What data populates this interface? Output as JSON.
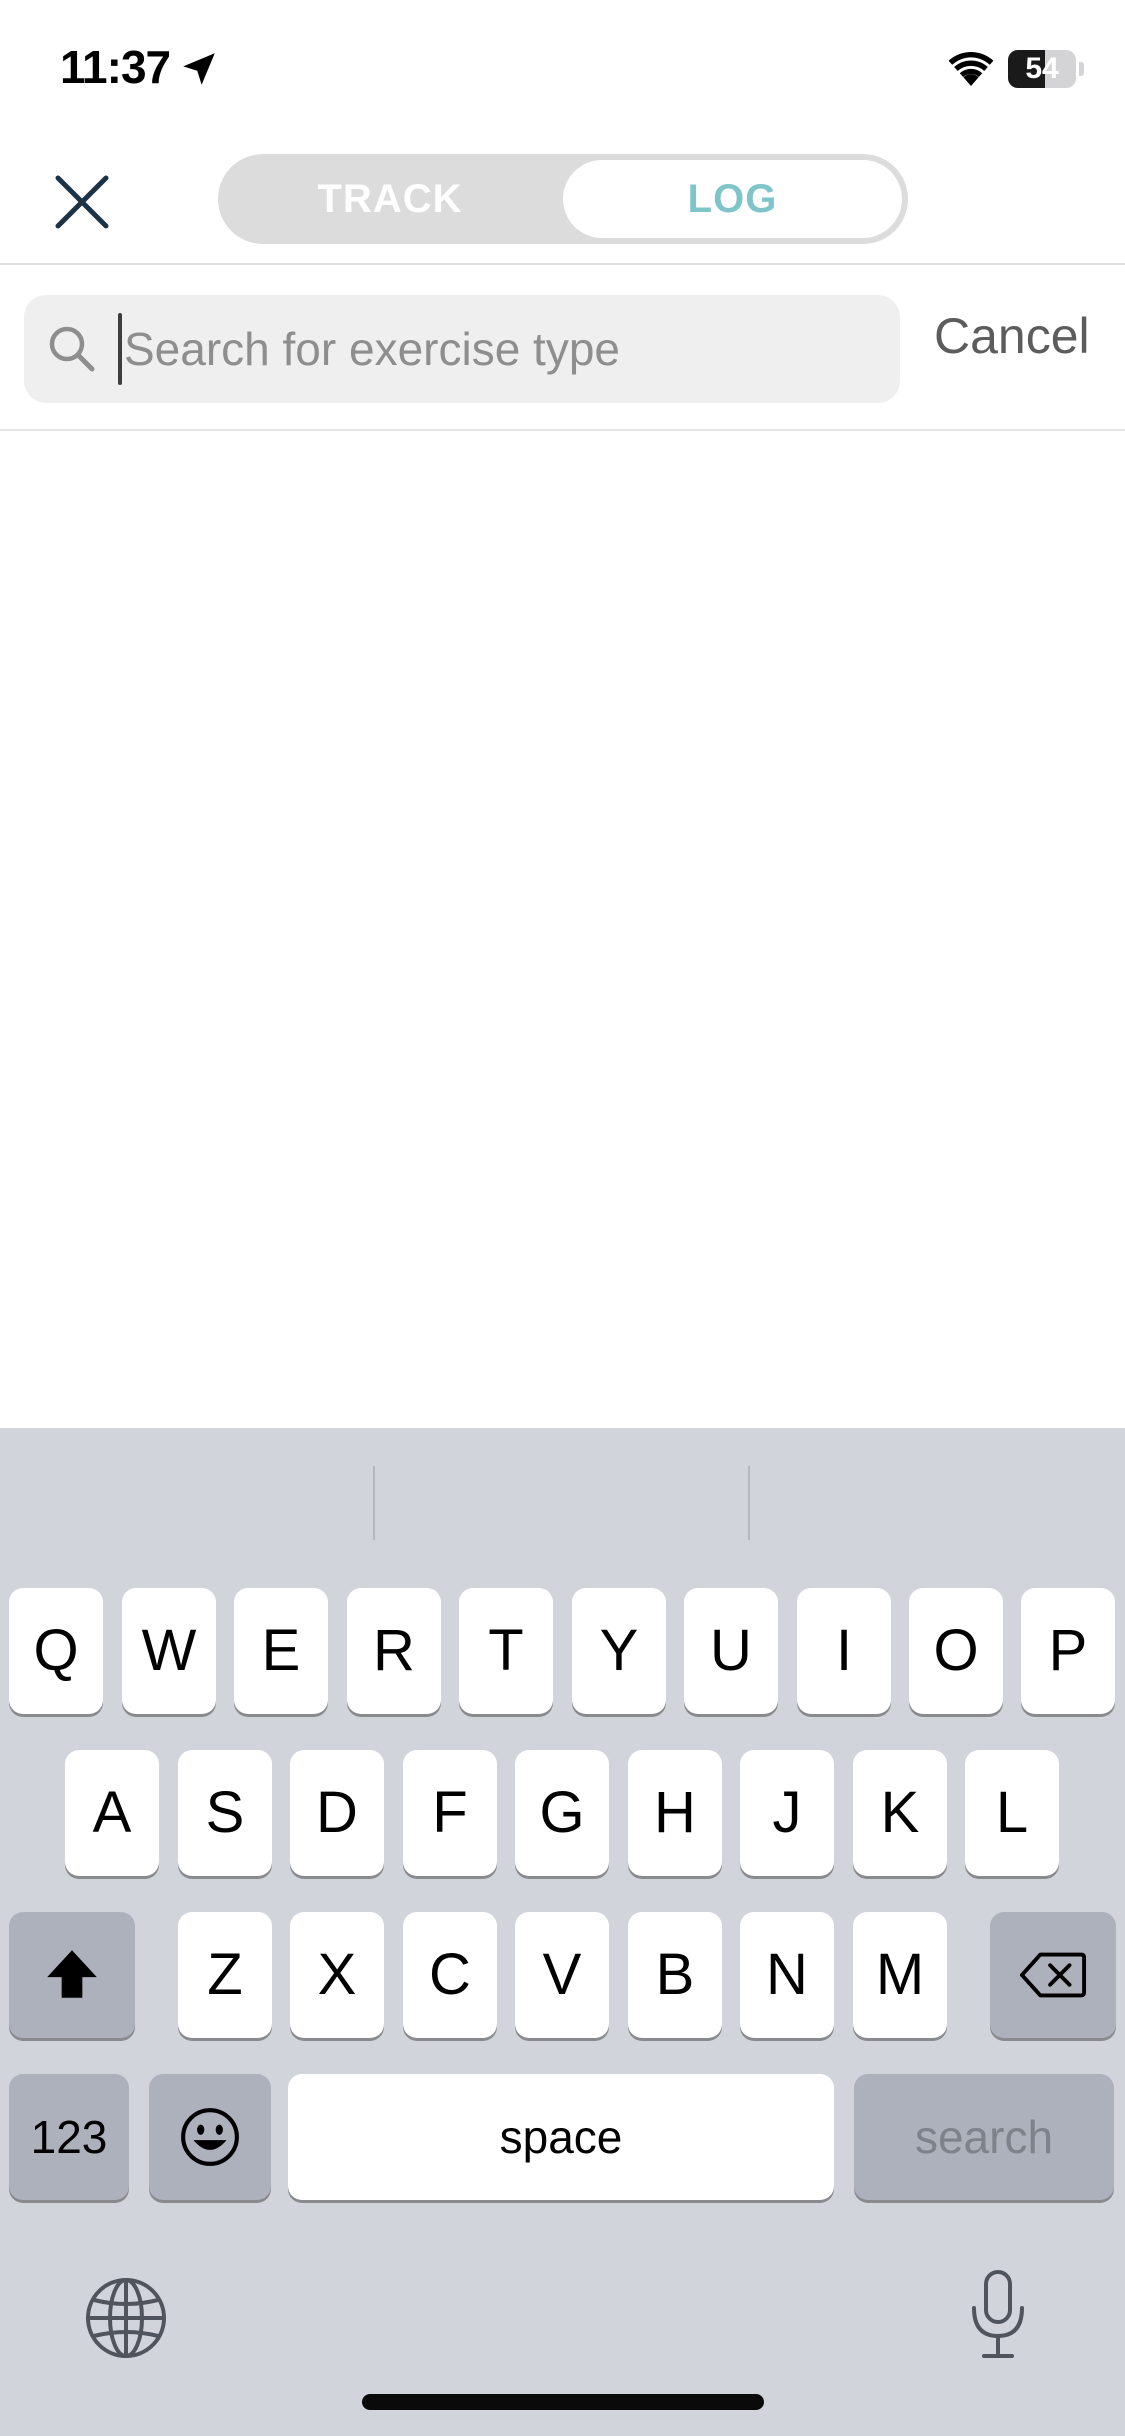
{
  "status_bar": {
    "time": "11:37",
    "battery_level": "54",
    "battery_fraction": 0.54
  },
  "header": {
    "tabs": [
      {
        "label": "TRACK",
        "selected": false
      },
      {
        "label": "LOG",
        "selected": true
      }
    ],
    "accent_color": "#7fc4c9"
  },
  "search": {
    "placeholder": "Search for exercise type",
    "value": "",
    "cancel_label": "Cancel"
  },
  "keyboard": {
    "row1": [
      "Q",
      "W",
      "E",
      "R",
      "T",
      "Y",
      "U",
      "I",
      "O",
      "P"
    ],
    "row2": [
      "A",
      "S",
      "D",
      "F",
      "G",
      "H",
      "J",
      "K",
      "L"
    ],
    "row3": [
      "Z",
      "X",
      "C",
      "V",
      "B",
      "N",
      "M"
    ],
    "numbers_label": "123",
    "space_label": "space",
    "search_label": "search"
  }
}
